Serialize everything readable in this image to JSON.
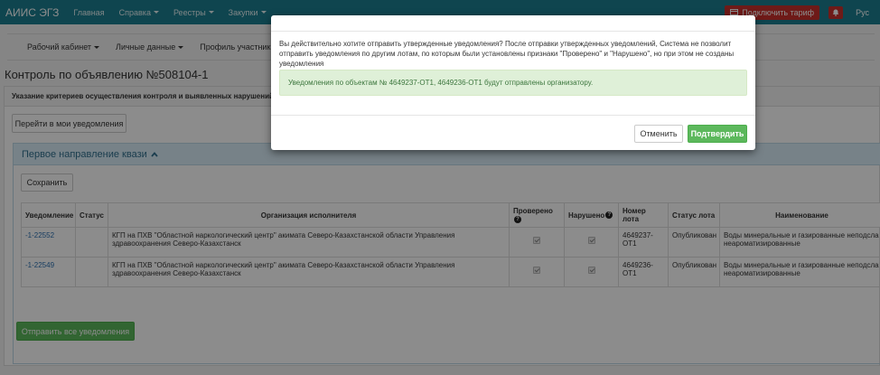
{
  "navbar": {
    "brand": "АИИС ЭГЗ",
    "items": [
      {
        "label": "Главная",
        "dropdown": false
      },
      {
        "label": "Справка",
        "dropdown": true
      },
      {
        "label": "Реестры",
        "dropdown": true
      },
      {
        "label": "Закупки",
        "dropdown": true
      }
    ],
    "tariff_label": "Подключить тариф",
    "lang": "Рус"
  },
  "subnav": {
    "items": [
      {
        "label": "Рабочий кабинет"
      },
      {
        "label": "Личные данные"
      },
      {
        "label": "Профиль участника"
      }
    ]
  },
  "page": {
    "title": "Контроль по объявлению №508104-1"
  },
  "panel": {
    "heading": "Указание критериев осуществления контроля и выявленных нарушений",
    "goto_button": "Перейти в мои уведомления",
    "inner_heading": "Первое направление квази",
    "save_button": "Сохранить",
    "send_all_button": "Отправить все уведомления"
  },
  "table": {
    "headers": {
      "notice": "Уведомление",
      "status": "Статус",
      "org": "Организация исполнителя",
      "checked": "Проверено",
      "violated": "Нарушено",
      "lot_number": "Номер лота",
      "lot_status": "Статус лота",
      "name": "Наименование"
    },
    "rows": [
      {
        "notice": "-1-22552",
        "status": "",
        "org": "КГП на ПХВ \"Областной наркологический центр\" акимата Северо-Казахстанской области Управления здравоохранения Северо-Казахстанск",
        "checked": true,
        "violated": true,
        "lot_number": "4649237-ОТ1",
        "lot_status": "Опубликован",
        "name": "Воды минеральные и газированные неподсла неароматизированные"
      },
      {
        "notice": "-1-22549",
        "status": "",
        "org": "КГП на ПХВ \"Областной наркологический центр\" акимата Северо-Казахстанской области Управления здравоохранения Северо-Казахстанск",
        "checked": true,
        "violated": true,
        "lot_number": "4649236-ОТ1",
        "lot_status": "Опубликован",
        "name": "Воды минеральные и газированные неподсла неароматизированные"
      }
    ]
  },
  "modal": {
    "message": "Вы действительно хотите отправить утвержденные уведомления? После отправки утвержденных уведомлений, Система не позволит отправить уведомления по другим лотам, по которым были установлены признаки \"Проверено\" и \"Нарушено\", но при этом не созданы уведомления",
    "alert": "Уведомления по объектам № 4649237-ОТ1, 4649236-ОТ1 будут отправлены организатору.",
    "cancel_label": "Отменить",
    "confirm_label": "Подтвердить"
  },
  "colors": {
    "navbar": "#1d7f91",
    "success": "#5cb85c",
    "danger": "#c9302c",
    "info_bg": "#d9edf7"
  }
}
